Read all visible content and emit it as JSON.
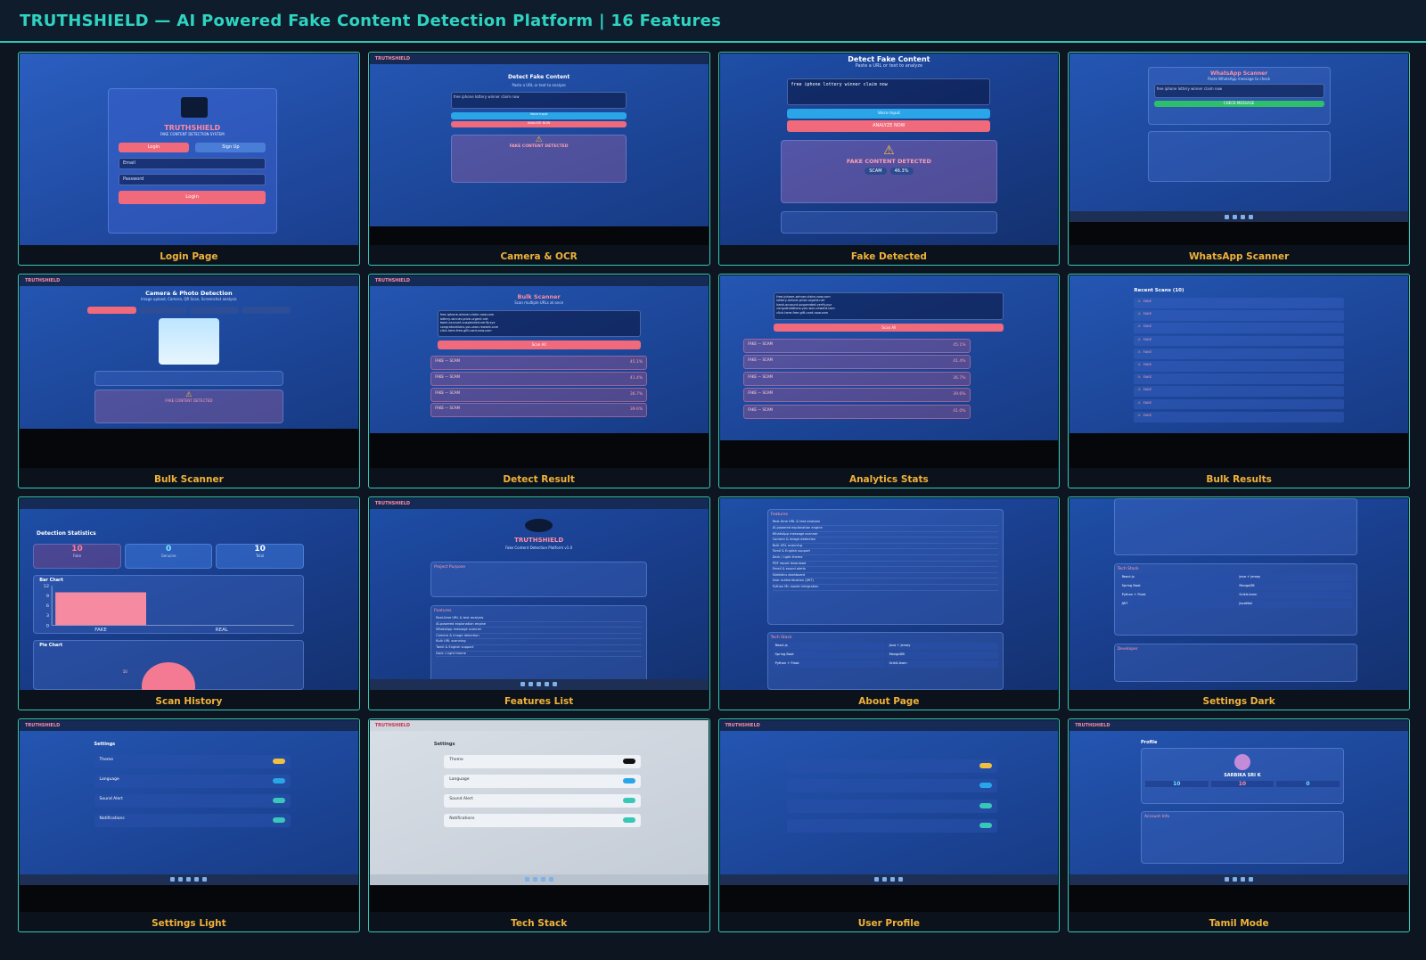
{
  "header": {
    "title": "TRUTHSHIELD  —  AI Powered Fake Content Detection Platform  |  16 Features"
  },
  "colors": {
    "accent": "#2fd3c2",
    "caption": "#f0b23a",
    "fake": "#f06a7c",
    "primary_blue": "#1e4fa8"
  },
  "tiles": [
    {
      "caption": "Login Page"
    },
    {
      "caption": "Camera & OCR"
    },
    {
      "caption": "Fake Detected"
    },
    {
      "caption": "WhatsApp Scanner"
    },
    {
      "caption": "Bulk Scanner"
    },
    {
      "caption": "Detect Result"
    },
    {
      "caption": "Analytics Stats"
    },
    {
      "caption": "Bulk Results"
    },
    {
      "caption": "Scan History"
    },
    {
      "caption": "Features List"
    },
    {
      "caption": "About Page"
    },
    {
      "caption": "Settings Dark"
    },
    {
      "caption": "Settings Light"
    },
    {
      "caption": "Tech Stack"
    },
    {
      "caption": "User Profile"
    },
    {
      "caption": "Tamil Mode"
    }
  ],
  "login": {
    "brand": "TRUTHSHIELD",
    "subtitle": "FAKE CONTENT DETECTION SYSTEM",
    "tab_login": "Login",
    "tab_signup": "Sign Up",
    "email_placeholder": "Email",
    "password_placeholder": "Password",
    "login_button": "Login"
  },
  "detect": {
    "title": "Detect Fake Content",
    "subtitle": "Paste a URL or text to analyze",
    "input_value": "free iphone lottery winner claim now",
    "voice_button": "Voice Input",
    "analyze_button": "ANALYZE NOW",
    "result": "FAKE CONTENT DETECTED",
    "verdict": "SCAM",
    "score": "46.3%"
  },
  "whatsapp": {
    "title": "WhatsApp Scanner",
    "subtitle": "Paste WhatsApp message to check",
    "input_value": "free iphone lottery winner claim now",
    "check_button": "CHECK MESSAGE"
  },
  "camera": {
    "title": "Camera & Photo Detection",
    "subtitle": "Image upload, Camera, QR Scan, Screenshot analysis",
    "result": "FAKE CONTENT DETECTED"
  },
  "bulk": {
    "title": "Bulk Scanner",
    "subtitle": "Scan multiple URLs at once",
    "scan_button": "Scan All",
    "lines": [
      "free-iphone-winner-claim-now.com",
      "lottery-winner-prize-urgent.net",
      "bank-account-suspended-verify.xyz",
      "congratulations-you-won-reward.com",
      "click-here-free-gift-card-now.com"
    ],
    "results": [
      {
        "label": "FAKE — SCAM",
        "pct": "45.1%"
      },
      {
        "label": "FAKE — SCAM",
        "pct": "41.4%"
      },
      {
        "label": "FAKE — SCAM",
        "pct": "36.7%"
      },
      {
        "label": "FAKE — SCAM",
        "pct": "39.6%"
      },
      {
        "label": "FAKE — SCAM",
        "pct": "41.0%"
      }
    ]
  },
  "recent": {
    "title": "Recent Scans (10)",
    "item_label": "FAKE"
  },
  "history": {
    "stats_title": "Detection Statistics",
    "fake_count": "10",
    "fake_label": "Fake",
    "genuine_count": "0",
    "genuine_label": "Genuine",
    "total_count": "10",
    "total_label": "Total",
    "bar_chart_title": "Bar Chart",
    "pie_chart_title": "Pie Chart",
    "axis_fake": "FAKE",
    "axis_real": "REAL",
    "pie_value": "10"
  },
  "chart_data": {
    "type": "bar",
    "title": "Bar Chart",
    "categories": [
      "FAKE",
      "REAL"
    ],
    "values": [
      10,
      0
    ],
    "yticks": [
      0,
      3,
      6,
      9,
      12
    ],
    "ylim": [
      0,
      12
    ]
  },
  "features": {
    "brand": "TRUTHSHIELD",
    "subtitle": "Fake Content Detection Platform v1.0",
    "purpose_title": "Project Purpose",
    "features_title": "Features",
    "items": [
      "Real-time URL & text analysis",
      "AI-powered explanation engine",
      "WhatsApp message scanner",
      "Camera & image detection",
      "Bulk URL scanning",
      "Tamil & English support",
      "Dark / Light theme",
      "PDF report download",
      "Email & sound alerts",
      "Statistics dashboard",
      "User authentication (JWT)",
      "Python ML model integration"
    ]
  },
  "about": {
    "tech_title": "Tech Stack",
    "tech": [
      "React.js",
      "Java + Jersey",
      "Spring Boot",
      "MongoDB",
      "Python + Flask",
      "Scikit-learn",
      "JWT",
      "JavaMail"
    ],
    "developer_title": "Developer"
  },
  "settings": {
    "title": "Settings",
    "rows": [
      "Theme",
      "Language",
      "Sound Alert",
      "Notifications"
    ]
  },
  "profile": {
    "title": "Profile",
    "name": "SARBIKA SRI K",
    "stat1": "10",
    "stat2": "10",
    "stat3": "0",
    "account_title": "Account Info"
  }
}
